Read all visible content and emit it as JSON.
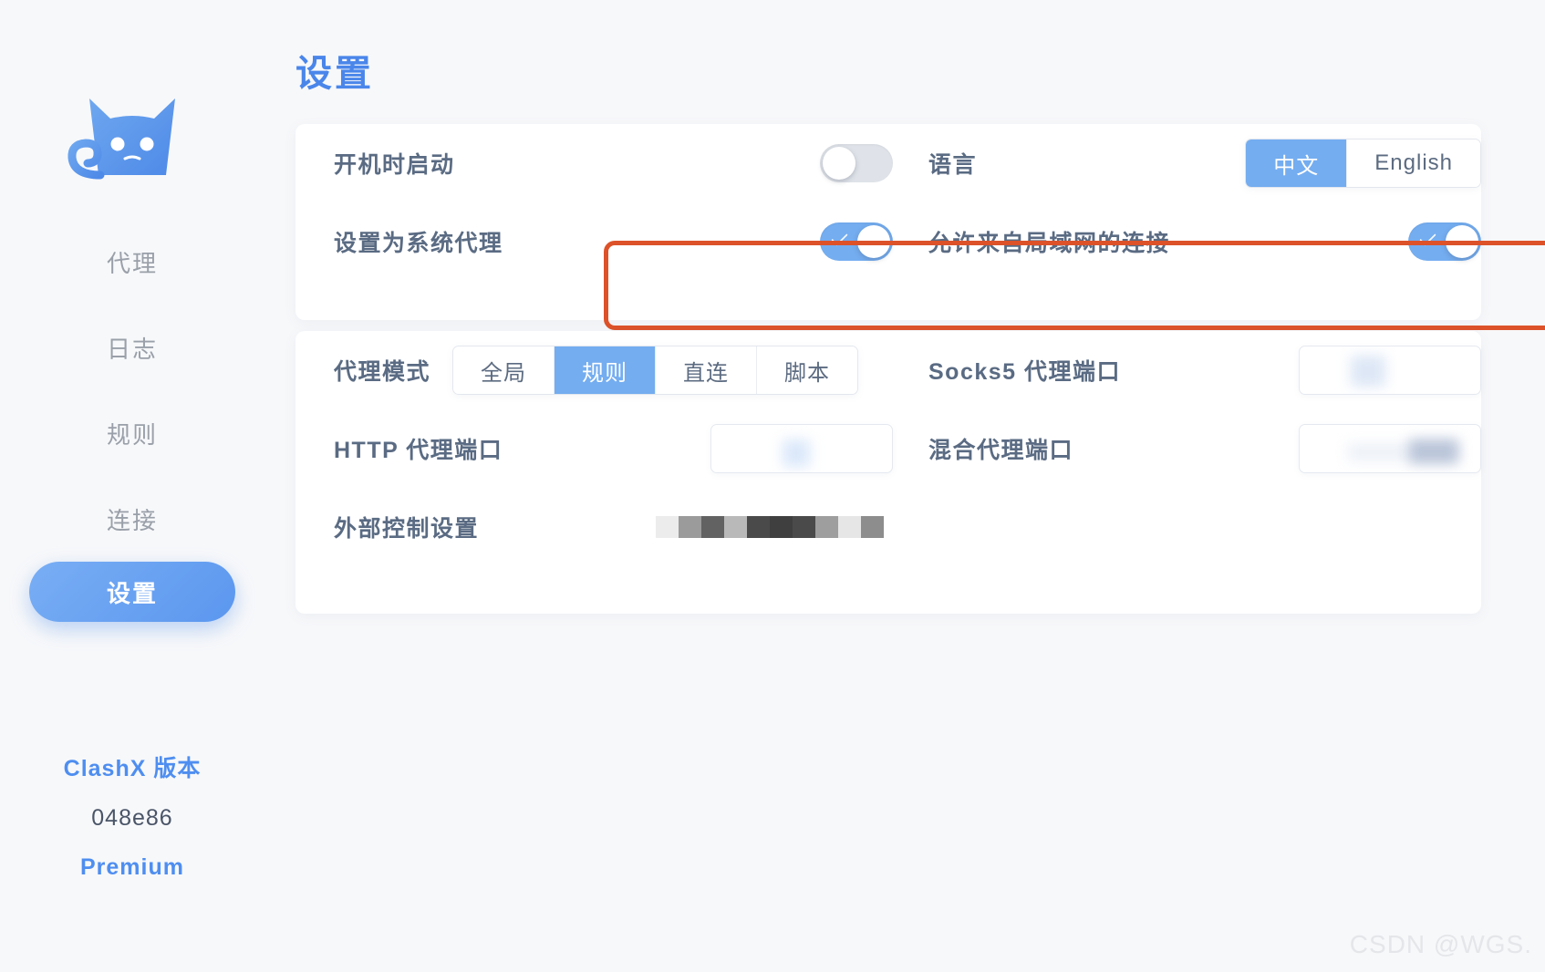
{
  "window": {
    "traffic_lights": [
      {
        "name": "close",
        "color": "#d9564f"
      },
      {
        "name": "minimize",
        "color": "#e9b53d"
      },
      {
        "name": "maximize",
        "color": "#64b551"
      }
    ]
  },
  "sidebar": {
    "logo_name": "clashx-cat-logo",
    "items": [
      {
        "label": "代理",
        "active": false
      },
      {
        "label": "日志",
        "active": false
      },
      {
        "label": "规则",
        "active": false
      },
      {
        "label": "连接",
        "active": false
      },
      {
        "label": "设置",
        "active": true
      }
    ],
    "footer": {
      "version_label": "ClashX 版本",
      "version_hash": "048e86",
      "edition": "Premium"
    }
  },
  "main": {
    "page_title": "设置",
    "card_top": {
      "rows": [
        {
          "left": {
            "label": "开机时启动",
            "control": "toggle",
            "value": false
          },
          "right": {
            "label": "语言",
            "control": "segmented",
            "options": [
              "中文",
              "English"
            ],
            "selected": "中文"
          }
        },
        {
          "left": {
            "label": "设置为系统代理",
            "control": "toggle",
            "value": true
          },
          "right": {
            "label": "允许来自局域网的连接",
            "control": "toggle",
            "value": true
          }
        }
      ],
      "annotation": {
        "type": "highlight-rectangle",
        "color": "#dd5229"
      }
    },
    "card_bottom": {
      "rows": [
        {
          "left": {
            "label": "代理模式",
            "control": "segmented",
            "options": [
              "全局",
              "规则",
              "直连",
              "脚本"
            ],
            "selected": "规则"
          },
          "right": {
            "label": "Socks5 代理端口",
            "control": "textbox",
            "value": "",
            "redacted": true
          }
        },
        {
          "left": {
            "label": "HTTP 代理端口",
            "control": "textbox",
            "value": "",
            "redacted": true
          },
          "right": {
            "label": "混合代理端口",
            "control": "textbox",
            "value": "",
            "redacted": true
          }
        },
        {
          "left": {
            "label": "外部控制设置",
            "control": "mosaic",
            "value": "",
            "redacted": true
          },
          "right": {
            "label": "",
            "control": "none"
          }
        }
      ]
    }
  },
  "watermark": "CSDN @WGS.",
  "colors": {
    "accent_blue": "#74adf0",
    "title_blue": "#4a86ea",
    "label_slate": "#5a6b83",
    "annotation_red": "#dd5229",
    "page_bg": "#f7f8fa",
    "card_bg": "#ffffff"
  }
}
